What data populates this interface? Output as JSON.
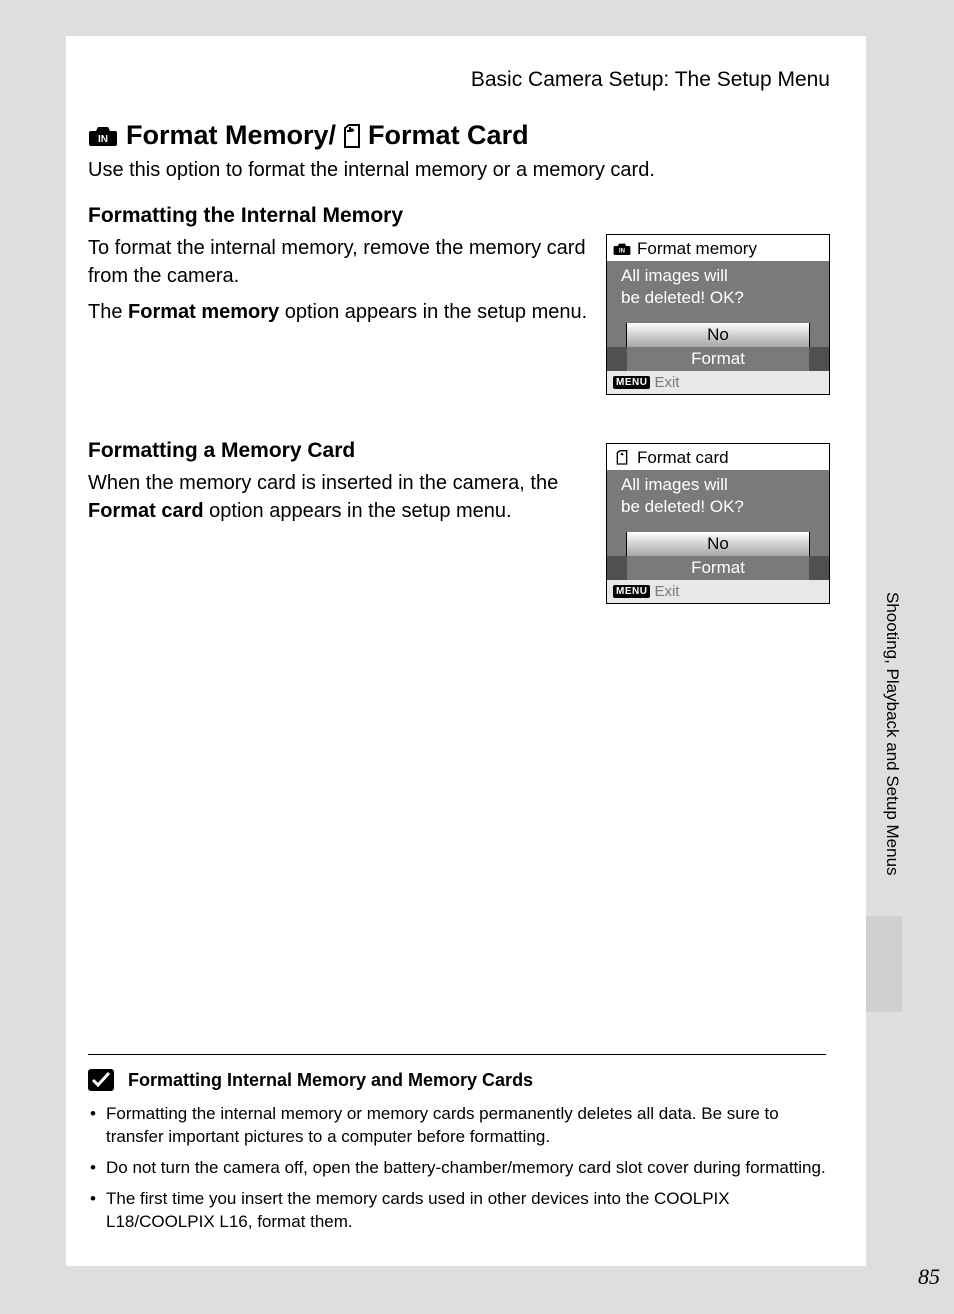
{
  "breadcrumb": "Basic Camera Setup: The Setup Menu",
  "title": {
    "part1": "Format Memory/",
    "part2": "Format Card"
  },
  "intro": "Use this option to format the internal memory or a memory card.",
  "section1": {
    "heading": "Formatting the Internal Memory",
    "p1": "To format the internal memory, remove the memory card from the camera.",
    "p2a": "The ",
    "p2b": "Format memory",
    "p2c": " option appears in the setup menu."
  },
  "section2": {
    "heading": "Formatting a Memory Card",
    "p1a": "When the memory card is inserted in the camera, the ",
    "p1b": "Format card",
    "p1c": " option appears in the setup menu."
  },
  "dialog1": {
    "title": "Format memory",
    "line1": "All images will",
    "line2": "be deleted! OK?",
    "opt_no": "No",
    "opt_format": "Format",
    "menu": "MENU",
    "exit": "Exit"
  },
  "dialog2": {
    "title": "Format card",
    "line1": "All images will",
    "line2": "be deleted! OK?",
    "opt_no": "No",
    "opt_format": "Format",
    "menu": "MENU",
    "exit": "Exit"
  },
  "side_tab": "Shooting, Playback and Setup Menus",
  "note": {
    "heading": "Formatting Internal Memory and Memory Cards",
    "items": [
      "Formatting the internal memory or memory cards permanently deletes all data. Be sure to transfer important pictures to a computer before formatting.",
      "Do not turn the camera off, open the battery-chamber/memory card slot cover during formatting.",
      "The first time you insert the memory cards used in other devices into the COOLPIX L18/COOLPIX L16, format them."
    ]
  },
  "page_number": "85"
}
